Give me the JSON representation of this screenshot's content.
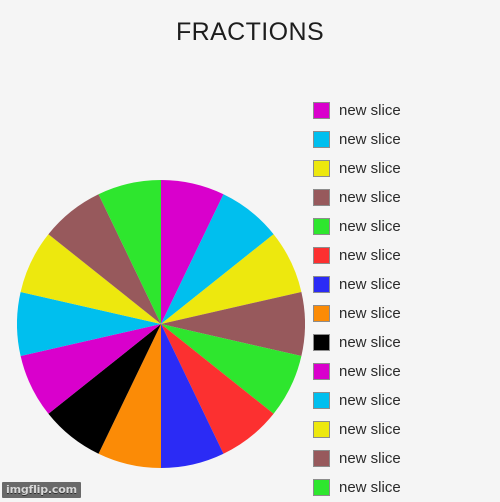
{
  "chart_data": {
    "type": "pie",
    "title": "FRACTIONS",
    "xlabel": "",
    "ylabel": "",
    "legend_position": "right",
    "grid": false,
    "slice_count": 14,
    "equal_slices": true,
    "start_angle_deg": 0,
    "direction": "clockwise",
    "categories": [
      "new slice",
      "new slice",
      "new slice",
      "new slice",
      "new slice",
      "new slice",
      "new slice",
      "new slice",
      "new slice",
      "new slice",
      "new slice",
      "new slice",
      "new slice",
      "new slice"
    ],
    "values": [
      1,
      1,
      1,
      1,
      1,
      1,
      1,
      1,
      1,
      1,
      1,
      1,
      1,
      1
    ],
    "percentages": [
      "7.14",
      "7.14",
      "7.14",
      "7.14",
      "7.14",
      "7.14",
      "7.14",
      "7.14",
      "7.14",
      "7.14",
      "7.14",
      "7.14",
      "7.14",
      "7.14"
    ],
    "colors": [
      "#d900cc",
      "#00bfee",
      "#ede80e",
      "#97595c",
      "#2ee62e",
      "#fc3030",
      "#2b2bf5",
      "#fb8b06",
      "#000000",
      "#d900cc",
      "#00bfee",
      "#ede80e",
      "#97595c",
      "#2ee62e"
    ],
    "slices": [
      {
        "label": "new slice",
        "value": 1,
        "color": "#d900cc"
      },
      {
        "label": "new slice",
        "value": 1,
        "color": "#00bfee"
      },
      {
        "label": "new slice",
        "value": 1,
        "color": "#ede80e"
      },
      {
        "label": "new slice",
        "value": 1,
        "color": "#97595c"
      },
      {
        "label": "new slice",
        "value": 1,
        "color": "#2ee62e"
      },
      {
        "label": "new slice",
        "value": 1,
        "color": "#fc3030"
      },
      {
        "label": "new slice",
        "value": 1,
        "color": "#2b2bf5"
      },
      {
        "label": "new slice",
        "value": 1,
        "color": "#fb8b06"
      },
      {
        "label": "new slice",
        "value": 1,
        "color": "#000000"
      },
      {
        "label": "new slice",
        "value": 1,
        "color": "#d900cc"
      },
      {
        "label": "new slice",
        "value": 1,
        "color": "#00bfee"
      },
      {
        "label": "new slice",
        "value": 1,
        "color": "#ede80e"
      },
      {
        "label": "new slice",
        "value": 1,
        "color": "#97595c"
      },
      {
        "label": "new slice",
        "value": 1,
        "color": "#2ee62e"
      }
    ]
  },
  "legend": {
    "entries": [
      {
        "label": "new slice",
        "color": "#d900cc"
      },
      {
        "label": "new slice",
        "color": "#00bfee"
      },
      {
        "label": "new slice",
        "color": "#ede80e"
      },
      {
        "label": "new slice",
        "color": "#97595c"
      },
      {
        "label": "new slice",
        "color": "#2ee62e"
      },
      {
        "label": "new slice",
        "color": "#fc3030"
      },
      {
        "label": "new slice",
        "color": "#2b2bf5"
      },
      {
        "label": "new slice",
        "color": "#fb8b06"
      },
      {
        "label": "new slice",
        "color": "#000000"
      },
      {
        "label": "new slice",
        "color": "#d900cc"
      },
      {
        "label": "new slice",
        "color": "#00bfee"
      },
      {
        "label": "new slice",
        "color": "#ede80e"
      },
      {
        "label": "new slice",
        "color": "#97595c"
      },
      {
        "label": "new slice",
        "color": "#2ee62e"
      }
    ]
  },
  "watermark": {
    "text": "imgflip.com"
  },
  "canvas": {
    "background_color": "#f5f5f5"
  }
}
